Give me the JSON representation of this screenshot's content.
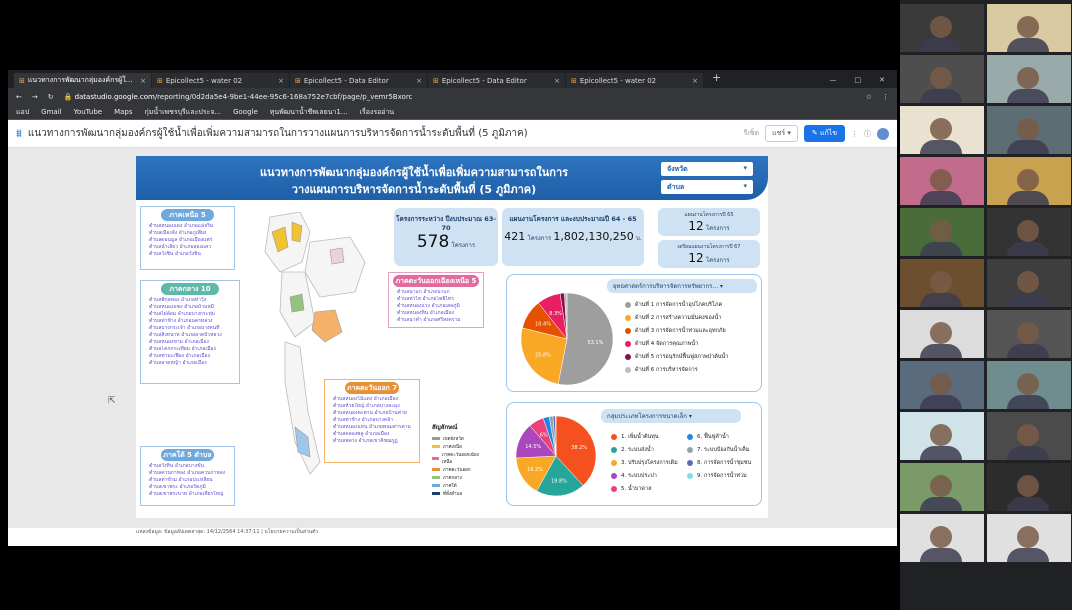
{
  "browser": {
    "tabs": [
      {
        "label": "แนวทางการพัฒนากลุ่มองค์กรผู้ใช้น้ำ",
        "active": true
      },
      {
        "label": "Epicollect5 - water 02"
      },
      {
        "label": "Epicollect5 - Data Editor"
      },
      {
        "label": "Epicollect5 - Data Editor"
      },
      {
        "label": "Epicollect5 - water 02"
      }
    ],
    "url_host": "datastudio.google.com",
    "url_path": "/reporting/0d2da5e4-9be1-44ee-95c6-168a752e7cbf/page/p_vemr5Bxorc",
    "bookmarks": [
      "แอป",
      "Gmail",
      "YouTube",
      "Maps",
      "กุ่มน้ำเพชรบุรีและประจ...",
      "Google",
      "ทุนพัฒนาน้ำชีพเลยนา1...",
      "เรื่องรออ่าน"
    ]
  },
  "app": {
    "title": "แนวทางการพัฒนากลุ่มองค์กรผู้ใช้น้ำเพื่อเพิ่มความสามารถในการวางแผนการบริหารจัดการน้ำระดับพื้นที่ (5 ภูมิภาค)",
    "reset_label": "รีเซ็ต",
    "share_label": "แชร์",
    "edit_label": "แก้ไข"
  },
  "report": {
    "title_line1": "แนวทางการพัฒนากลุ่มองค์กรผู้ใช้น้ำเพื่อเพิ่มความสามารถในการ",
    "title_line2": "วางแผนการบริหารจัดการน้ำระดับพื้นที่ (5 ภูมิภาค)",
    "filter_province": "จังหวัด",
    "filter_district": "ตำบล",
    "regions": {
      "north": {
        "title": "ภาคเหนือ 5 ตำบล",
        "lines": [
          "ตำบลหนองแดง อำเภอแม่จริม",
          "ตำบลเมืองจัง อำเภอภูเพียง",
          "ตำบลดอนมูล อำเภอเมืองแพร่",
          "ตำบลน้ำเลี้ยว อำเภอสองแคว",
          "ตำบลวังชิ้น อำเภอวังชิ้น"
        ]
      },
      "central": {
        "title": "ภาคกลาง 10 ตำบล",
        "lines": [
          "ตำบลพิกุลทอง อำเภอท่าวุ้ง",
          "ตำบลหนองแซง อำเภอบ้านหมี่",
          "ตำบลไผ่ล้อม อำเภอบางกระทุ่ม",
          "ตำบลท่าช้าง อำเภอนครหลวง",
          "ตำบลบางกระเจ้า อำเภอบางคนที",
          "ตำบลสิงหนาท อำเภอลาดบัวหลวง",
          "ตำบลหนองขาม อำเภอเมือง",
          "ตำบลโคกกระเทียม อำเภอเมือง",
          "ตำบลท่ามะเฟือง อำเภอเมือง",
          "ตำบลลาดหญ้า อำเภอเมือง"
        ]
      },
      "south": {
        "title": "ภาคใต้ 5 ตำบล",
        "lines": [
          "ตำบลวังหิน อำเภอบางขัน",
          "ตำบลควนกาหลง อำเภอควนกาหลง",
          "ตำบลท่าข้าม อำเภอปะเหลียน",
          "ตำบลเขาพระ อำเภอรัตภูมิ",
          "ตำบลเขาพระบาท อำเภอเชียรใหญ่"
        ]
      },
      "northeast": {
        "title": "ภาคตะวันออกเฉียงเหนือ 5 ตำบล",
        "lines": [
          "ตำบลนาแก อำเภอนาแก",
          "ตำบลท่าไฮ อำเภอโพธิ์ไทร",
          "ตำบลหนองแวง อำเภอเสลภูมิ",
          "ตำบลหนองหิน อำเภอเมือง",
          "ตำบลนาคำ อำเภอศรีสงคราม"
        ]
      },
      "east": {
        "title": "ภาคตะวันออก 7 ตำบล",
        "lines": [
          "ตำบลหนองไม้แดง อำเภอเมือง",
          "ตำบลห้วยใหญ่ อำเภอบางละมุง",
          "ตำบลหนองตะพาน อำเภอบ้านค่าย",
          "ตำบลท่าช้าง อำเภอบางคล้า",
          "ตำบลหนองแหน อำเภอพนมสารคาม",
          "ตำบลคลองพลู อำเภอเมือง",
          "ตำบลพลวง อำเภอเขาคิชฌกูฏ"
        ]
      }
    },
    "map_legend": {
      "title": "สัญลักษณ์",
      "items": [
        "เขตจังหวัด",
        "ภาคเหนือ",
        "ภาคตะวันออกเฉียงเหนือ",
        "ภาคตะวันออก",
        "ภาคกลาง",
        "ภาคใต้",
        "ที่ตั้งตำบล"
      ]
    },
    "kpi_projects": {
      "label": "โครงการระหว่าง ปีงบประมาณ 63-70",
      "value": "578",
      "unit": "โครงการ"
    },
    "kpi_plan": {
      "label": "แผนงานโครงการ และงบประมาณปี 64 - 65",
      "count": "421",
      "count_unit": "โครงการ",
      "budget": "1,802,130,250",
      "budget_unit": "บ."
    },
    "kpi_y65": {
      "label": "แผนงานโครงการปี 65",
      "value": "12",
      "unit": "โครงการ"
    },
    "kpi_y67": {
      "label": "เตรียมแผนงานโครงการปี 67",
      "value": "12",
      "unit": "โครงการ"
    },
    "strategy_panel": {
      "dropdown": "ยุทธศาสตร์การบริหารจัดการทรัพยากร...",
      "legend": [
        "ด้านที่ 1 การจัดการน้ำอุปโภคบริโภค",
        "ด้านที่ 2 การสร้างความมั่นคงของน้ำ",
        "ด้านที่ 3 การจัดการน้ำท่วมและอุทกภัย",
        "ด้านที่ 4 จัดการคุณภาพน้ำ",
        "ด้านที่ 5 การอนุรักษ์ฟื้นฟูสภาพป่าต้นน้ำ",
        "ด้านที่ 6 การบริหารจัดการ"
      ]
    },
    "type_panel": {
      "dropdown": "กลุ่มประเภทโครงการขนาดเล็ก",
      "legend": [
        "1. เพิ่มน้ำต้นทุน",
        "2. ระบบส่งน้ำ",
        "3. ปรับปรุงโครงการเดิม",
        "4. ระบบประปา",
        "5. น้ำบาดาล",
        "6. ฟื้นฟูลำน้ำ",
        "7. ระบบป้องกันน้ำเค็ม",
        "8. การจัดการน้ำชุมชน",
        "9. การจัดการน้ำท่วม"
      ]
    },
    "footer": "แหล่งข้อมูล: ข้อมูลอัปเดตล่าสุด: 14/12/2564 14:37:11 | นโยบายความเป็นส่วนตัว"
  },
  "chart_data": [
    {
      "type": "pie",
      "title": "ยุทธศาสตร์การบริหารจัดการทรัพยากร...",
      "categories": [
        "ด้านที่ 1",
        "ด้านที่ 2",
        "ด้านที่ 3",
        "ด้านที่ 4",
        "ด้านที่ 5",
        "ด้านที่ 6"
      ],
      "values": [
        53.1,
        25.8,
        10.4,
        8.3,
        1.5,
        0.9
      ],
      "labels": [
        "53.1%",
        "25.8%",
        "10.4%",
        "8.3%",
        "",
        ""
      ],
      "colors": [
        "#9e9e9e",
        "#f9a825",
        "#e65100",
        "#e91e63",
        "#880e4f",
        "#bdbdbd"
      ]
    },
    {
      "type": "pie",
      "title": "กลุ่มประเภทโครงการขนาดเล็ก",
      "categories": [
        "1",
        "2",
        "3",
        "4",
        "5",
        "6",
        "7",
        "8",
        "9"
      ],
      "values": [
        38.2,
        19.8,
        16.2,
        14.5,
        6.1,
        2.5,
        1.5,
        1.0,
        0.2
      ],
      "labels": [
        "38.2%",
        "19.8%",
        "16.2%",
        "14.5%",
        "6%",
        "",
        "",
        "",
        ""
      ],
      "colors": [
        "#f4511e",
        "#26a69a",
        "#f9a825",
        "#ab47bc",
        "#ec407a",
        "#1e88e5",
        "#90a4ae",
        "#5c6bc0",
        "#80deea"
      ]
    }
  ],
  "meeting": {
    "participant_count": 22
  }
}
